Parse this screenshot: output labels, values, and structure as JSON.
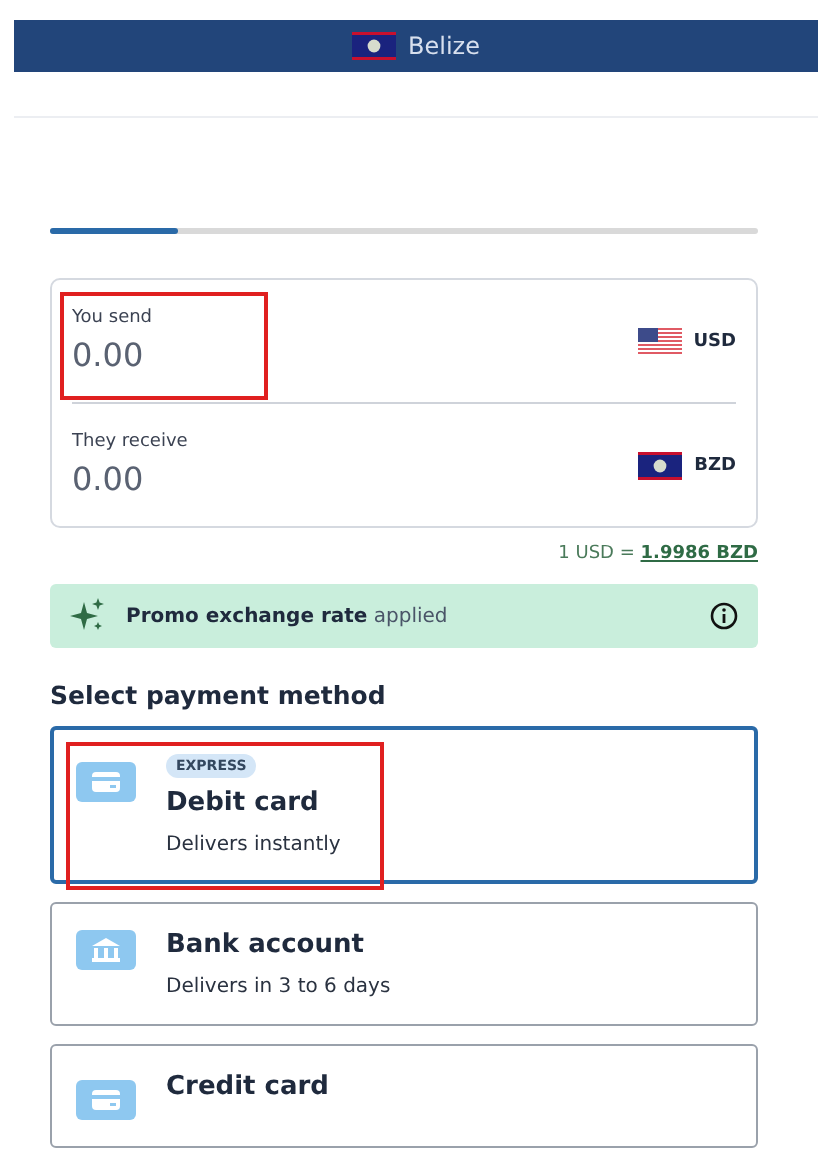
{
  "header": {
    "country": "Belize"
  },
  "progress": {
    "level": 0.18
  },
  "converter": {
    "fields": [
      {
        "label": "You send",
        "placeholder": "0.00",
        "currency": "USD",
        "kind": "us",
        "highlighted": true
      },
      {
        "label": "They receive",
        "placeholder": "0.00",
        "currency": "BZD",
        "kind": "bz",
        "highlighted": false
      }
    ]
  },
  "rate": {
    "prefix": "1 USD = ",
    "link": "1.9986 BZD"
  },
  "promo": {
    "text": "**Promo exchange rate** applied"
  },
  "payment": {
    "heading": "Select payment method",
    "methods": [
      {
        "kind": "card",
        "badge": "EXPRESS",
        "title": "Debit card",
        "subtitle": "Delivers instantly",
        "selected": true,
        "highlighted": true
      },
      {
        "kind": "bank",
        "title": "Bank account",
        "subtitle": "Delivers in 3 to 6 days",
        "selected": false,
        "highlighted": false
      },
      {
        "kind": "card",
        "title": "Credit card",
        "selected": false,
        "highlighted": false
      }
    ]
  }
}
